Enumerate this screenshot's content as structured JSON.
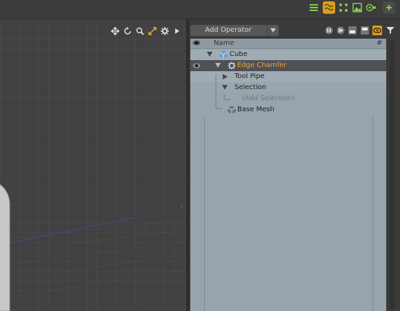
{
  "topbar": {
    "buttons": [
      {
        "icon": "list-icon",
        "active": false
      },
      {
        "icon": "schematic-icon",
        "active": true
      },
      {
        "icon": "nodes-icon",
        "active": false
      },
      {
        "icon": "image-icon",
        "active": false
      },
      {
        "icon": "gear-toggle-icon",
        "active": false
      },
      {
        "icon": "add-icon",
        "active": false
      }
    ]
  },
  "viewport": {
    "tools": [
      "move-icon",
      "rotate-icon",
      "zoom-icon",
      "fit-icon",
      "settings-icon",
      "expand-arrow-icon"
    ]
  },
  "panel": {
    "add_operator_label": "Add Operator",
    "header": {
      "name": "Name",
      "hash": "#"
    },
    "items": [
      {
        "label": "Cube",
        "icon": "cube-icon"
      },
      {
        "label": "Edge Chamfer",
        "icon": "gear-icon"
      },
      {
        "label": "Tool Pipe",
        "icon": ""
      },
      {
        "label": "Selection",
        "icon": ""
      },
      {
        "label": "(Add Selection)",
        "icon": ""
      },
      {
        "label": "Base Mesh",
        "icon": "mesh-icon"
      }
    ]
  },
  "colors": {
    "accent": "#e49a1b",
    "list_bg": "#98a4ad",
    "selected_row": "#4d5257"
  }
}
